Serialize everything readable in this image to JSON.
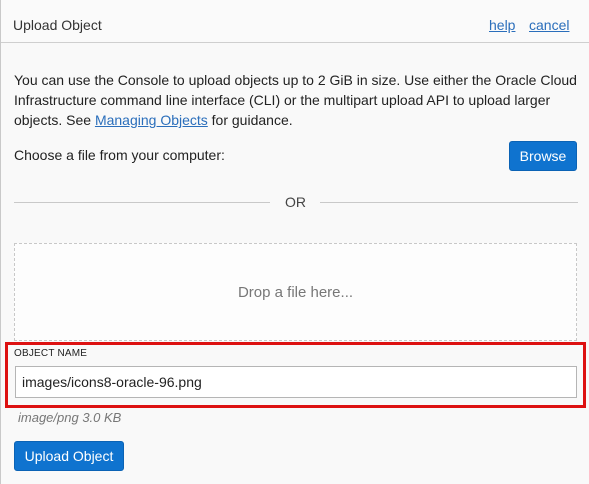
{
  "header": {
    "title": "Upload Object",
    "help_label": "help",
    "cancel_label": "cancel"
  },
  "description": {
    "text_before_link": "You can use the Console to upload objects up to 2 GiB in size. Use either the Oracle Cloud Infrastructure command line interface (CLI) or the multipart upload API to upload larger objects. See ",
    "link_text": "Managing Objects",
    "text_after_link": " for guidance."
  },
  "file_picker": {
    "choose_label": "Choose a file from your computer:",
    "browse_label": "Browse",
    "or_label": "OR",
    "drop_label": "Drop a file here..."
  },
  "object_name": {
    "label": "OBJECT NAME",
    "value": "images/icons8-oracle-96.png",
    "file_meta": "image/png 3.0 KB"
  },
  "actions": {
    "upload_label": "Upload Object"
  },
  "colors": {
    "primary_button": "#0f73cf",
    "link": "#2a6ebb",
    "highlight": "#dd1111"
  }
}
